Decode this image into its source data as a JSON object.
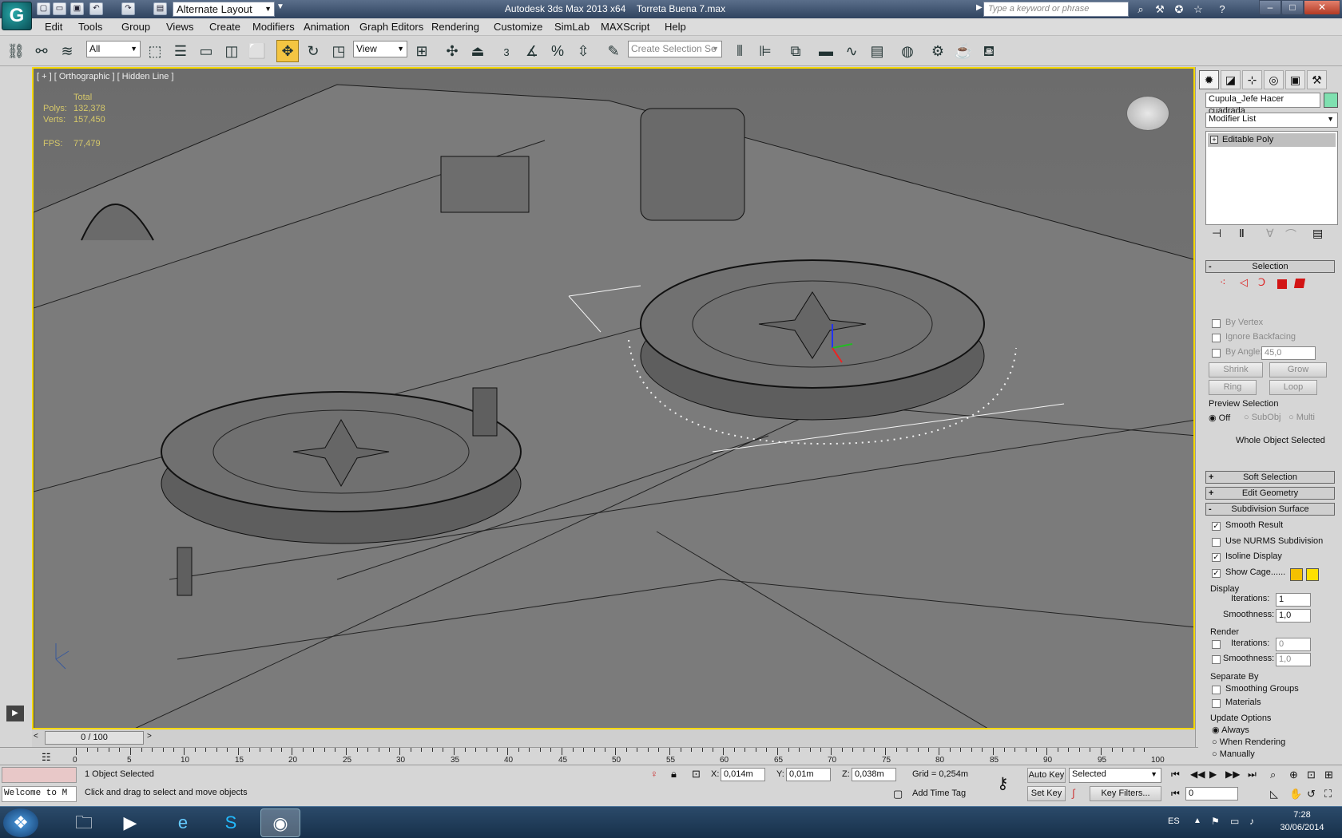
{
  "window": {
    "title": "Autodesk 3ds Max  2013 x64",
    "file": "Torreta Buena 7.max",
    "layout": "Alternate Layout",
    "search_placeholder": "Type a keyword or phrase",
    "logo": "G",
    "min": "–",
    "max": "□",
    "close": "✕"
  },
  "menu": [
    "Edit",
    "Tools",
    "Group",
    "Views",
    "Create",
    "Modifiers",
    "Animation",
    "Graph Editors",
    "Rendering",
    "Customize",
    "SimLab",
    "MAXScript",
    "Help"
  ],
  "toolbar": {
    "filter": "All",
    "refcoord": "View",
    "selset_placeholder": "Create Selection Se",
    "snap": "3"
  },
  "viewport": {
    "label": "[ + ] [ Orthographic ] [ Hidden Line ]",
    "stats_title": "Total",
    "polys_label": "Polys:",
    "polys": "132,378",
    "verts_label": "Verts:",
    "verts": "157,450",
    "fps_label": "FPS:",
    "fps": "77,479"
  },
  "panel": {
    "object_name": "Cupula_Jefe Hacer cuadrada",
    "object_color": "#7fe0b0",
    "modifier_list": "Modifier List",
    "stack_item": "Editable Poly",
    "selection": {
      "title": "Selection",
      "by_vertex": "By Vertex",
      "ignore_backfacing": "Ignore Backfacing",
      "by_angle": "By Angle:",
      "angle": "45,0",
      "shrink": "Shrink",
      "grow": "Grow",
      "ring": "Ring",
      "loop": "Loop",
      "preview": "Preview Selection",
      "off": "Off",
      "subobj": "SubObj",
      "multi": "Multi",
      "status": "Whole Object Selected"
    },
    "soft": "Soft Selection",
    "edit_geo": "Edit Geometry",
    "subdiv": {
      "title": "Subdivision Surface",
      "smooth": "Smooth Result",
      "nurms": "Use NURMS Subdivision",
      "isoline": "Isoline Display",
      "cage": "Show Cage......",
      "cage_color1": "#f4c000",
      "cage_color2": "#ffe000",
      "display": "Display",
      "iterations": "Iterations:",
      "iter_val": "1",
      "smoothness": "Smoothness:",
      "smooth_val": "1,0",
      "render": "Render",
      "r_iter": "0",
      "r_smooth": "1,0",
      "separate": "Separate By",
      "sgroups": "Smoothing Groups",
      "materials": "Materials",
      "update": "Update Options",
      "always": "Always",
      "when_render": "When Rendering",
      "manually": "Manually"
    }
  },
  "time": {
    "slider": "0 / 100",
    "ticks": [
      "0",
      "5",
      "10",
      "15",
      "20",
      "25",
      "30",
      "35",
      "40",
      "45",
      "50",
      "55",
      "60",
      "65",
      "70",
      "75",
      "80",
      "85",
      "90",
      "95",
      "100"
    ]
  },
  "status": {
    "welcome": "Welcome to M",
    "selected": "1 Object Selected",
    "prompt": "Click and drag to select and move objects",
    "x_label": "X:",
    "x": "0,014m",
    "y_label": "Y:",
    "y": "0,01m",
    "z_label": "Z:",
    "z": "0,038m",
    "grid": "Grid = 0,254m",
    "add_time_tag": "Add Time Tag",
    "auto_key": "Auto Key",
    "set_key": "Set Key",
    "key_mode": "Selected",
    "key_filters": "Key Filters...",
    "frame": "0"
  },
  "taskbar": {
    "lang": "ES",
    "time": "7:28",
    "date": "30/06/2014"
  }
}
